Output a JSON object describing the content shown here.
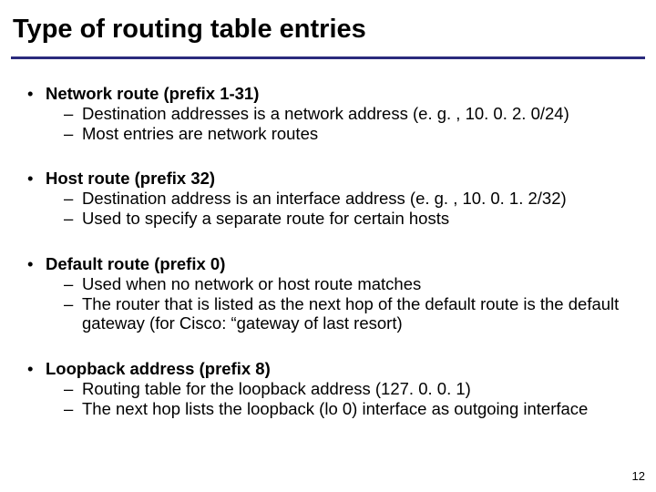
{
  "slide": {
    "title": "Type of routing table entries",
    "page_number": "12",
    "bullets": [
      {
        "heading": "Network route (prefix 1-31)",
        "subs": [
          "Destination addresses is a network address (e. g. , 10. 0. 2. 0/24)",
          "Most entries are network routes"
        ]
      },
      {
        "heading": "Host route (prefix 32)",
        "subs": [
          "Destination address is an interface address (e. g. , 10. 0. 1. 2/32)",
          "Used to specify a separate route for certain hosts"
        ]
      },
      {
        "heading": "Default route (prefix 0)",
        "subs": [
          "Used when no network or host route matches",
          "The router that is listed as the next hop of the default route is the default gateway (for Cisco: “gateway of last resort)"
        ]
      },
      {
        "heading": "Loopback address (prefix 8)",
        "subs": [
          "Routing table for the loopback address (127. 0. 0. 1)",
          "The next hop lists the loopback (lo 0) interface as outgoing interface"
        ]
      }
    ]
  }
}
